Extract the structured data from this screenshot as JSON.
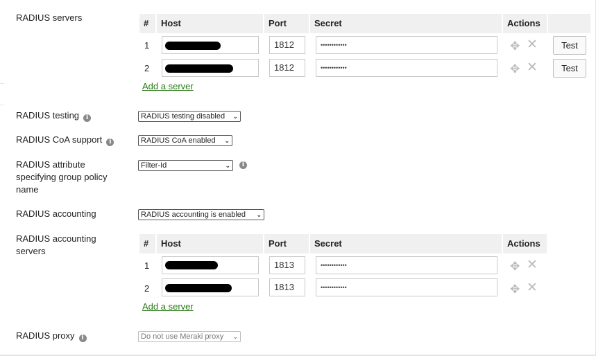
{
  "radius_servers": {
    "label": "RADIUS servers",
    "columns": [
      "#",
      "Host",
      "Port",
      "Secret",
      "Actions"
    ],
    "rows": [
      {
        "num": "1",
        "port": "1812",
        "secret": "••••••••••••",
        "test": "Test"
      },
      {
        "num": "2",
        "port": "1812",
        "secret": "••••••••••••",
        "test": "Test"
      }
    ],
    "add_link": "Add a server"
  },
  "radius_testing": {
    "label": "RADIUS testing",
    "value": "RADIUS testing disabled"
  },
  "radius_coa": {
    "label": "RADIUS CoA support",
    "value": "RADIUS CoA enabled"
  },
  "radius_attribute": {
    "label": "RADIUS attribute specifying group policy name",
    "value": "Filter-Id"
  },
  "radius_accounting": {
    "label": "RADIUS accounting",
    "value": "RADIUS accounting is enabled"
  },
  "accounting_servers": {
    "label": "RADIUS accounting servers",
    "columns": [
      "#",
      "Host",
      "Port",
      "Secret",
      "Actions"
    ],
    "rows": [
      {
        "num": "1",
        "port": "1813",
        "secret": "••••••••••••"
      },
      {
        "num": "2",
        "port": "1813",
        "secret": "••••••••••••"
      }
    ],
    "add_link": "Add a server"
  },
  "radius_proxy": {
    "label": "RADIUS proxy",
    "value": "Do not use Meraki proxy"
  },
  "icons": {
    "info": "info-icon",
    "move": "move-icon",
    "remove": "close-icon",
    "dropdown": "chevron-down-icon"
  },
  "colors": {
    "link": "#2a7a18",
    "header_bg": "#f0f0f0",
    "icon_gray": "#bbbbbb"
  }
}
